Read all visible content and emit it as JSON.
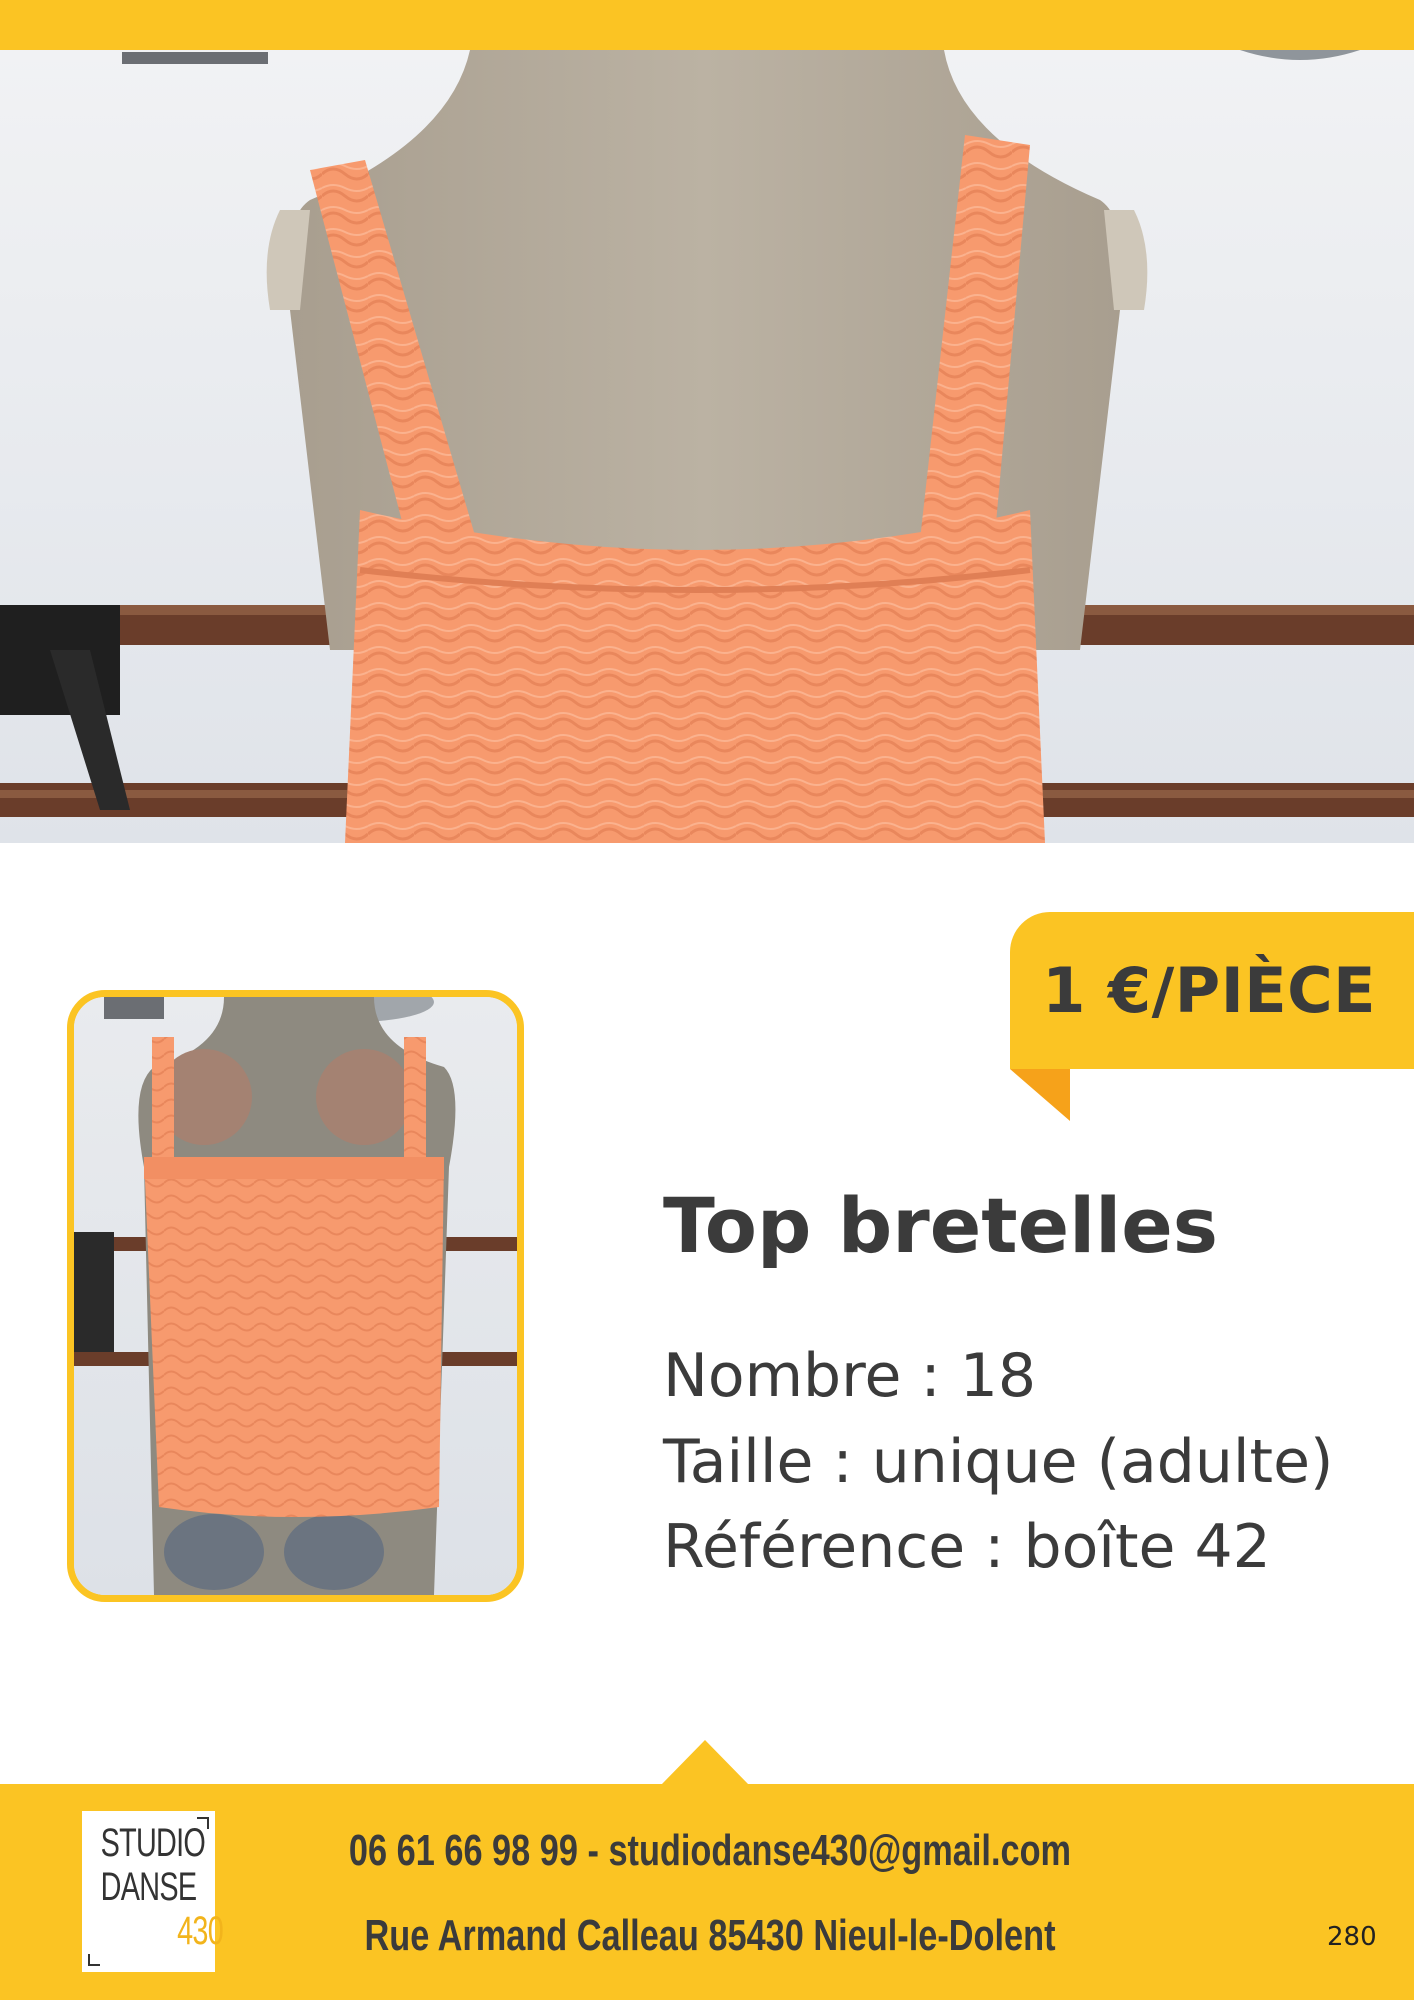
{
  "price": {
    "label": "1 €/PIÈCE"
  },
  "product": {
    "title": "Top bretelles",
    "details": [
      "Nombre : 18",
      "Taille : unique (adulte)",
      "Référence : boîte 42"
    ]
  },
  "footer": {
    "logo": {
      "line1": "STUDIO",
      "line2": "DANSE",
      "line3": "430"
    },
    "contact_line": "06 61 66 98 99 - studiodanse430@gmail.com",
    "address_line": "Rue Armand Calleau 85430 Nieul-le-Dolent",
    "page_number": "280"
  },
  "colors": {
    "accent": "#FBC423",
    "accent_dark": "#F6A21A",
    "text": "#3b3b3b",
    "garment": "#F79A6E"
  },
  "images": {
    "hero": "photo-back-of-orange-top-on-mannequin",
    "thumbnail": "photo-front-of-orange-top-on-mannequin"
  }
}
